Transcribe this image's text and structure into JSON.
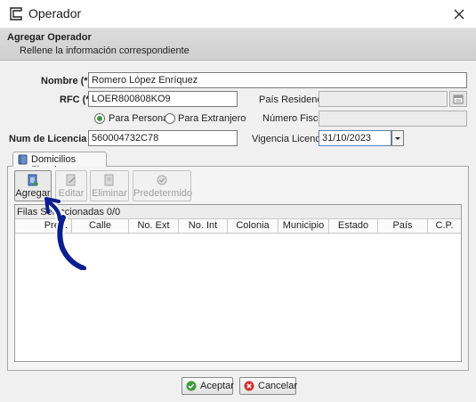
{
  "window": {
    "title": "Operador",
    "icon": "window-icon",
    "close_icon": "close-icon"
  },
  "header": {
    "title": "Agregar Operador",
    "subtitle": "Rellene la información correspondiente"
  },
  "form": {
    "nombre": {
      "label": "Nombre (*)",
      "value": "Romero López Enríquez"
    },
    "rfc": {
      "label": "RFC (*)",
      "value": "LOER800808KO9"
    },
    "pais_residencia": {
      "label": "País Residencia",
      "value": ""
    },
    "persona_radio": {
      "label": "Para Persona",
      "selected": true
    },
    "extranjero_radio": {
      "label": "Para Extranjero",
      "selected": false
    },
    "numero_fiscal": {
      "label": "Número Fiscal",
      "value": ""
    },
    "licencia": {
      "label": "Num de Licencia (*)",
      "value": "560004732C78"
    },
    "vigencia": {
      "label": "Vigencia Licencia",
      "value": "31/10/2023"
    }
  },
  "tabs": [
    {
      "label": "Domicilios Fiscales",
      "icon": "book-icon",
      "active": true
    }
  ],
  "toolbar": {
    "agregar": "Agregar",
    "editar": "Editar",
    "eliminar": "Eliminar",
    "predeterminado": "Predetermido"
  },
  "grid": {
    "selection_label": "Filas Seleccionadas  0/0",
    "columns": [
      "Pred.",
      "Calle",
      "No. Ext",
      "No. Int",
      "Colonia",
      "Municipio",
      "Estado",
      "País",
      "C.P."
    ],
    "rows": []
  },
  "buttons": {
    "aceptar": "Aceptar",
    "cancelar": "Cancelar"
  },
  "colors": {
    "accent_green": "#3c9a3c",
    "cancel_red": "#d32f2f",
    "annotation_arrow": "#0b1f8f"
  }
}
